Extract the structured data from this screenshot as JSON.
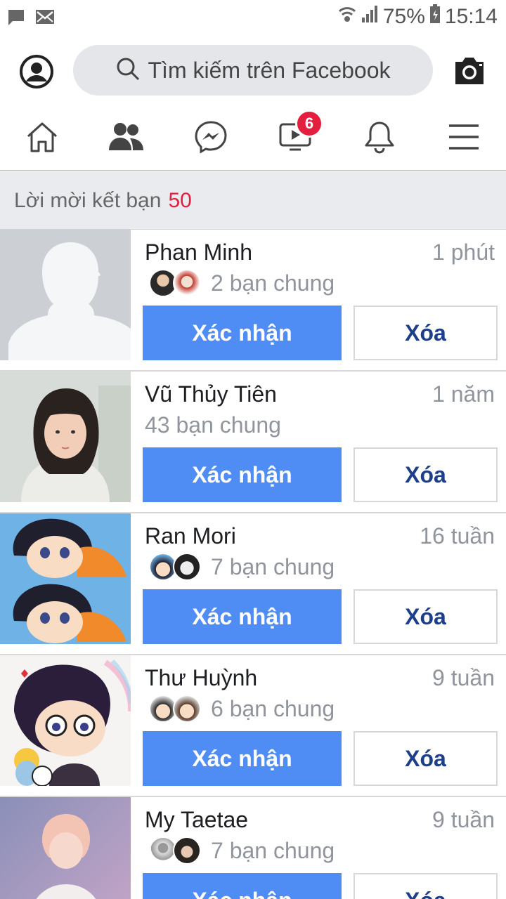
{
  "status_bar": {
    "battery": "75%",
    "time": "15:14",
    "icons": [
      "message-icon",
      "mail-icon",
      "wifi-icon",
      "signal-icon",
      "battery-icon"
    ]
  },
  "search": {
    "placeholder": "Tìm kiếm trên Facebook"
  },
  "nav": {
    "items": [
      "home-icon",
      "friends-icon",
      "messenger-icon",
      "watch-icon",
      "notifications-icon",
      "menu-icon"
    ],
    "watch_badge": "6"
  },
  "requests_header": {
    "label": "Lời mời kết bạn",
    "count": "50"
  },
  "colors": {
    "primary": "#4f8df5",
    "badge": "#e41e3f",
    "delete_text": "#1d3f8a"
  },
  "requests": [
    {
      "name": "Phan Minh",
      "time": "1 phút",
      "mutual": "2 bạn chung",
      "confirm": "Xác nhận",
      "delete": "Xóa"
    },
    {
      "name": "Vũ Thủy Tiên",
      "time": "1 năm",
      "mutual": "43 bạn chung",
      "confirm": "Xác nhận",
      "delete": "Xóa"
    },
    {
      "name": "Ran Mori",
      "time": "16 tuần",
      "mutual": "7 bạn chung",
      "confirm": "Xác nhận",
      "delete": "Xóa"
    },
    {
      "name": "Thư Huỳnh",
      "time": "9 tuần",
      "mutual": "6 bạn chung",
      "confirm": "Xác nhận",
      "delete": "Xóa"
    },
    {
      "name": "My Taetae",
      "time": "9 tuần",
      "mutual": "7 bạn chung",
      "confirm": "Xác nhận",
      "delete": "Xóa"
    }
  ]
}
